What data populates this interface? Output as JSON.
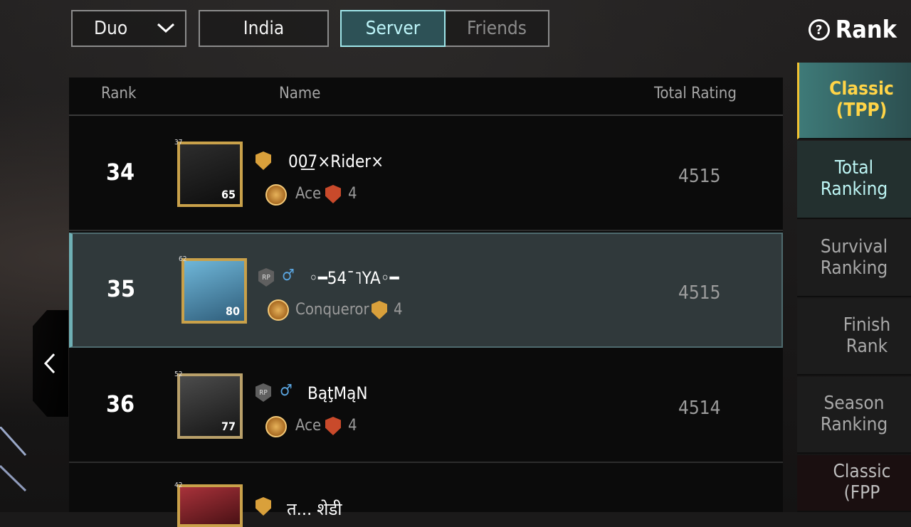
{
  "filters": {
    "mode": "Duo",
    "region": "India",
    "server": "Server",
    "friends": "Friends"
  },
  "header": {
    "title": "Rank"
  },
  "table": {
    "columns": [
      "Rank",
      "Name",
      "Total Rating"
    ],
    "rows": [
      {
        "rank": "34",
        "name": "00͟7×Rider×",
        "tier": "Ace",
        "tier_count": "4",
        "rating": "4515",
        "avatar_level": "65",
        "badge": "37"
      },
      {
        "rank": "35",
        "name": "◦━54ˉ˥YA◦━",
        "tier": "Conqueror",
        "tier_count": "4",
        "rating": "4515",
        "avatar_level": "80",
        "badge": "62"
      },
      {
        "rank": "36",
        "name": "BąţMąN",
        "tier": "Ace",
        "tier_count": "4",
        "rating": "4514",
        "avatar_level": "77",
        "badge": "52"
      },
      {
        "rank": "",
        "name": "त… शेडी",
        "badge": "42"
      }
    ]
  },
  "side_tabs": {
    "category_tpp": "Classic (TPP)",
    "total": "Total Ranking",
    "survival": "Survival Ranking",
    "finish": "Finish Rank",
    "season": "Season Ranking",
    "category_fpp": "Classic (FPP"
  },
  "colors": {
    "accent": "#9fe6ea",
    "highlight_row": "#30393b",
    "gold": "#ffd447"
  }
}
